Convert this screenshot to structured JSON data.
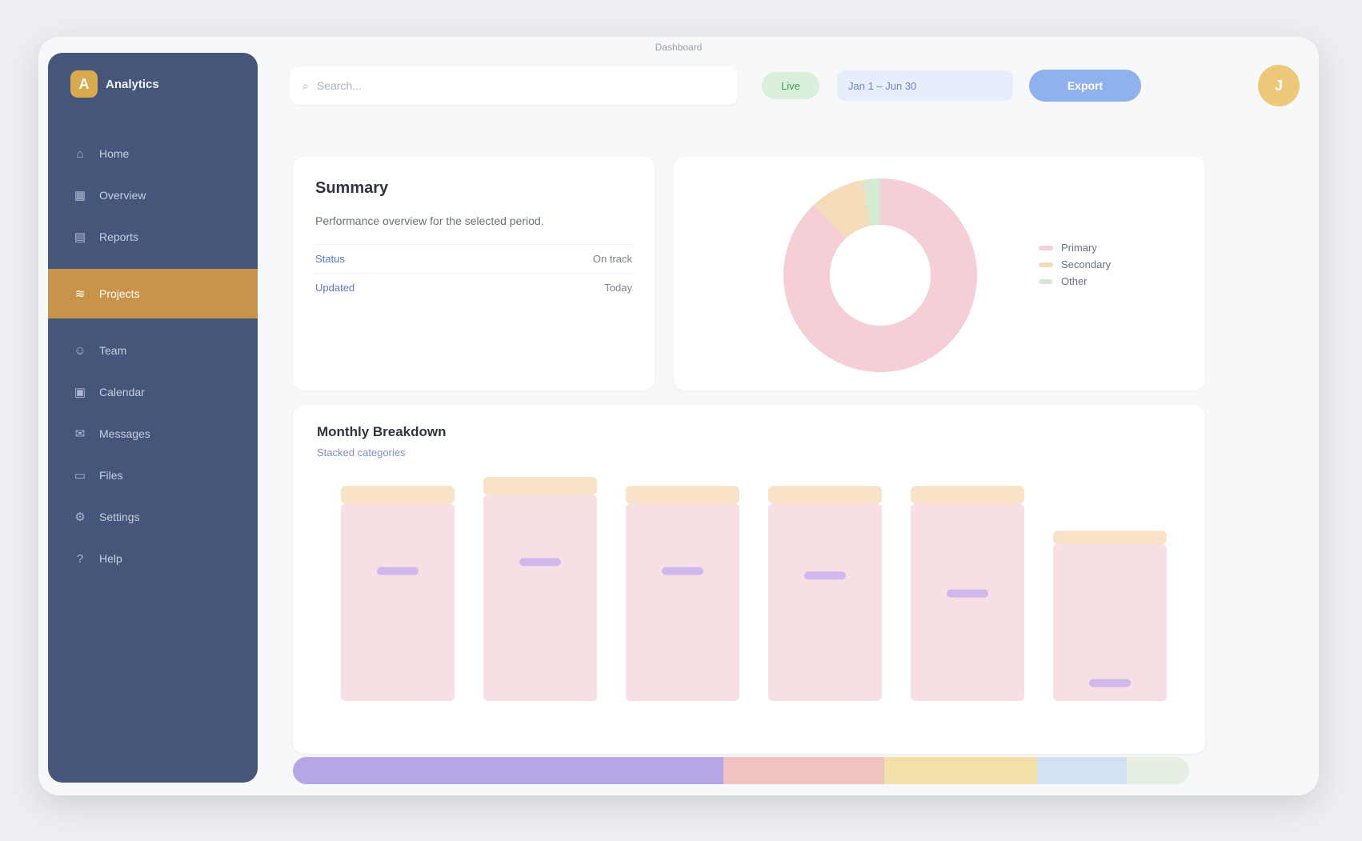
{
  "window": {
    "title": "Dashboard"
  },
  "sidebar": {
    "brand_initial": "A",
    "brand_name": "Analytics",
    "items": [
      {
        "icon": "home-icon",
        "glyph": "⌂",
        "label": "Home"
      },
      {
        "icon": "grid-icon",
        "glyph": "▦",
        "label": "Overview"
      },
      {
        "icon": "chart-icon",
        "glyph": "▤",
        "label": "Reports"
      },
      {
        "icon": "layers-icon",
        "glyph": "≋",
        "label": "Projects",
        "active": true
      },
      {
        "icon": "users-icon",
        "glyph": "☺",
        "label": "Team"
      },
      {
        "icon": "calendar-icon",
        "glyph": "▣",
        "label": "Calendar"
      },
      {
        "icon": "mail-icon",
        "glyph": "✉",
        "label": "Messages"
      },
      {
        "icon": "folder-icon",
        "glyph": "▭",
        "label": "Files"
      },
      {
        "icon": "gear-icon",
        "glyph": "⚙",
        "label": "Settings"
      },
      {
        "icon": "help-icon",
        "glyph": "?",
        "label": "Help"
      }
    ]
  },
  "topbar": {
    "search_placeholder": "Search...",
    "status": "Live",
    "date_range": "Jan 1 – Jun 30",
    "primary_button": "Export",
    "avatar_initial": "J"
  },
  "summary": {
    "title": "Summary",
    "description": "Performance overview for the selected period.",
    "rows": [
      {
        "key": "Status",
        "value": "On track"
      },
      {
        "key": "Updated",
        "value": "Today"
      }
    ]
  },
  "donut": {
    "legend": [
      {
        "label": "Primary",
        "color": "#f6cfd6"
      },
      {
        "label": "Secondary",
        "color": "#f5dcb8"
      },
      {
        "label": "Other",
        "color": "#d6e9d2"
      }
    ]
  },
  "bars": {
    "title": "Monthly Breakdown",
    "subtitle": "Stacked categories"
  },
  "chart_data": [
    {
      "type": "pie",
      "values": [
        88,
        9,
        3
      ],
      "colors": [
        "#f6cfd6",
        "#f5dcb8",
        "#d6e9d2"
      ]
    },
    {
      "type": "bar",
      "categories": [
        "",
        "",
        "",
        "",
        "",
        ""
      ],
      "series": [
        {
          "values": [
            88,
            92,
            88,
            88,
            88,
            70
          ],
          "color": "#f8dfe4"
        },
        {
          "values": [
            8,
            8,
            8,
            8,
            8,
            6
          ],
          "color": "#f8e3c8"
        }
      ],
      "markers": [
        58,
        62,
        58,
        56,
        48,
        8
      ],
      "marker_color": "#cfb8ec",
      "ylim": [
        0,
        100
      ]
    }
  ],
  "footer_strip": [
    {
      "fraction": 0.48,
      "color": "#b7a6e6"
    },
    {
      "fraction": 0.18,
      "color": "#f0c2c2"
    },
    {
      "fraction": 0.17,
      "color": "#f3e0a8"
    },
    {
      "fraction": 0.1,
      "color": "#d2e2f2"
    },
    {
      "fraction": 0.07,
      "color": "#e6f0e2"
    }
  ]
}
